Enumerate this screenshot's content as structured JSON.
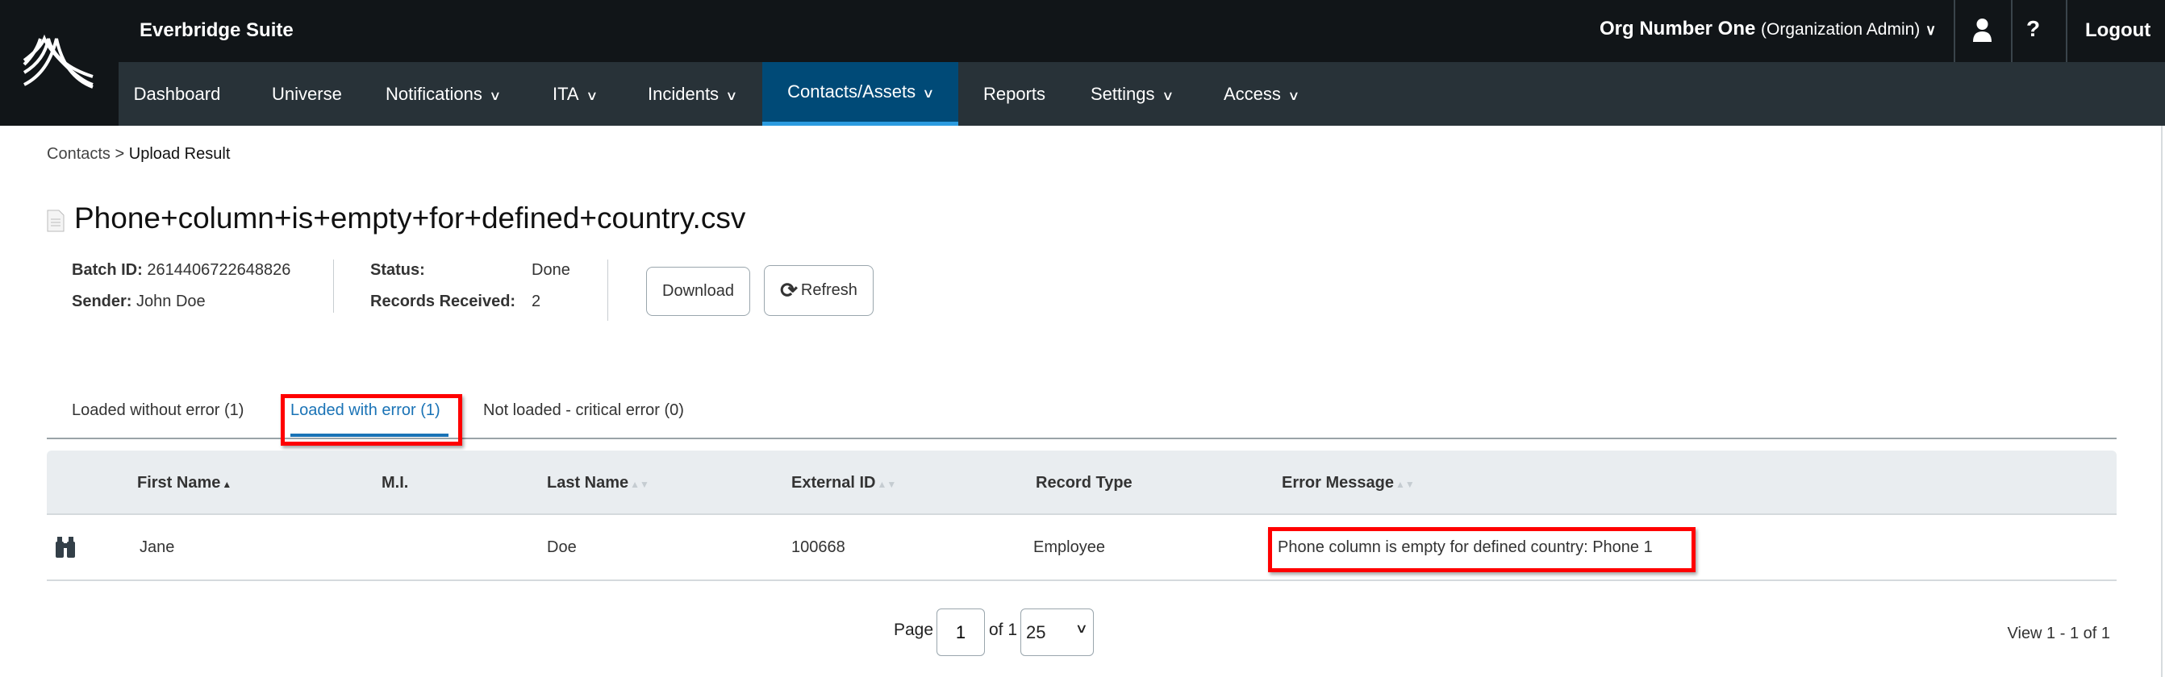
{
  "app": {
    "title": "Everbridge Suite"
  },
  "nav": {
    "items": [
      {
        "label": "Dashboard",
        "has_menu": false
      },
      {
        "label": "Universe",
        "has_menu": false
      },
      {
        "label": "Notifications",
        "has_menu": true
      },
      {
        "label": "ITA",
        "has_menu": true
      },
      {
        "label": "Incidents",
        "has_menu": true
      },
      {
        "label": "Contacts/Assets",
        "has_menu": true,
        "active": true
      },
      {
        "label": "Reports",
        "has_menu": false
      },
      {
        "label": "Settings",
        "has_menu": true
      },
      {
        "label": "Access",
        "has_menu": true
      }
    ]
  },
  "user": {
    "org": "Org Number One",
    "role": "(Organization Admin)",
    "logout": "Logout",
    "help": "?"
  },
  "breadcrumb": {
    "parent": "Contacts",
    "separator": ">",
    "current": "Upload Result"
  },
  "page": {
    "title": "Phone+column+is+empty+for+defined+country.csv"
  },
  "info": {
    "batch_label": "Batch ID:",
    "batch_value": "2614406722648826",
    "sender_label": "Sender:",
    "sender_value": "John Doe",
    "status_label": "Status:",
    "status_value": "Done",
    "records_label": "Records Received:",
    "records_value": "2"
  },
  "buttons": {
    "download": "Download",
    "refresh": "Refresh"
  },
  "tabs": [
    {
      "label": "Loaded without error (1)"
    },
    {
      "label": "Loaded with error (1)",
      "active": true
    },
    {
      "label": "Not loaded - critical error (0)"
    }
  ],
  "table": {
    "headers": [
      "First Name",
      "M.I.",
      "Last Name",
      "External ID",
      "Record Type",
      "Error Message"
    ],
    "rows": [
      {
        "first": "Jane",
        "mi": "",
        "last": "Doe",
        "external_id": "100668",
        "record_type": "Employee",
        "error": "Phone column is empty for defined country: Phone 1"
      }
    ]
  },
  "pagination": {
    "page_label": "Page",
    "page_value": "1",
    "of_label": "of 1",
    "page_size": "25",
    "view_text": "View 1 - 1 of 1"
  },
  "colors": {
    "topbar": "#111518",
    "navbar": "#283238",
    "nav_active": "#004a77",
    "accent": "#1a73b6",
    "highlight": "#ff0000"
  }
}
